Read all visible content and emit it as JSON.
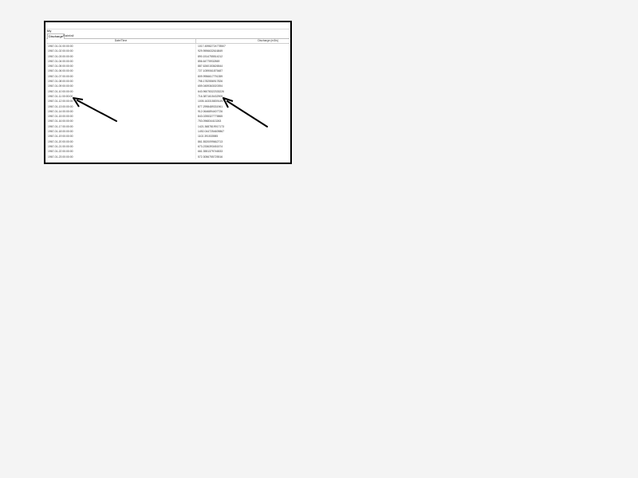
{
  "window": {
    "title": "tdy"
  },
  "tabs": [
    {
      "label": "Discharge",
      "selected": true
    },
    {
      "label": "Rainfall",
      "selected": false
    }
  ],
  "table": {
    "columns": [
      "Date/Time",
      "Discharge (m3/s)"
    ],
    "rows": [
      [
        "1967-01-01 00:00:00",
        "1017.45982724778507"
      ],
      [
        "1967-01-02 00:00:00",
        "929.9596632616849"
      ],
      [
        "1967-01-03 00:00:00",
        "890.1514755514212"
      ],
      [
        "1967-01-04 00:00:00",
        "856.64775932869"
      ],
      [
        "1967-01-05 00:00:00",
        "887.6260153626544"
      ],
      [
        "1967-01-06 00:00:00",
        "727.1059061875487"
      ],
      [
        "1967-01-07 00:00:00",
        "809.9956617791359"
      ],
      [
        "1967-01-08 00:00:00",
        "798.1782556917826"
      ],
      [
        "1967-01-09 00:00:00",
        "659.0459363020394"
      ],
      [
        "1967-01-10 00:00:00",
        "643.96078322333226"
      ],
      [
        "1967-01-11 00:00:00",
        "716.3871615432905"
      ],
      [
        "1967-01-12 00:00:00",
        "1005.1633158391497"
      ],
      [
        "1967-01-13 00:00:00",
        "877.2998489331961"
      ],
      [
        "1967-01-14 00:00:00",
        "912.0646894407726"
      ],
      [
        "1967-01-15 00:00:00",
        "843.0255327775865"
      ],
      [
        "1967-01-16 00:00:00",
        "753.096834413263"
      ],
      [
        "1967-01-17 00:00:00",
        "1421.3687819917173"
      ],
      [
        "1967-01-18 00:00:00",
        "1492.0447254609867"
      ],
      [
        "1967-01-19 00:00:00",
        "1102.391533985"
      ],
      [
        "1967-01-20 00:00:00",
        "861.5520099662713"
      ],
      [
        "1967-01-21 00:00:00",
        "673.2336393451574"
      ],
      [
        "1967-01-22 00:00:00",
        "661.3551379746533"
      ],
      [
        "1967-01-23 00:00:00",
        "572.3056755725516"
      ]
    ]
  },
  "colors": {
    "frame_border": "#000000",
    "background": "#f4f4f4",
    "arrow": "#000000"
  }
}
